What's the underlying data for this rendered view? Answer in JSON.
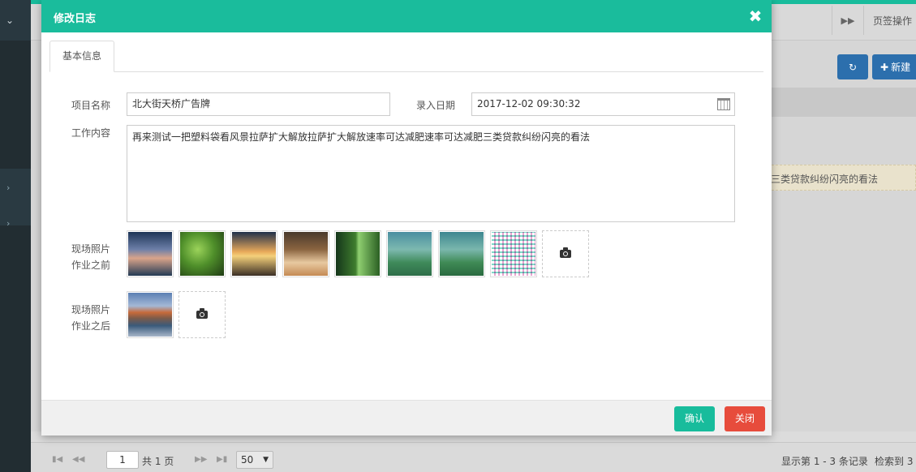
{
  "background": {
    "tab_operations": "页签操作",
    "new_button": "新建",
    "row_text": "三类贷款纠纷闪亮的看法",
    "footer": {
      "current_page": "1",
      "total_pages": "共 1 页",
      "page_size": "50",
      "showing": "显示第 1 - 3 条记录",
      "found": "检索到 3"
    }
  },
  "modal": {
    "title": "修改日志",
    "tab_basic": "基本信息",
    "form": {
      "project_label": "项目名称",
      "project_value": "北大街天桥广告牌",
      "date_label": "录入日期",
      "date_value": "2017-12-02 09:30:32",
      "work_label": "工作内容",
      "work_value": "再来测试一把塑料袋看风景拉萨扩大解放拉萨扩大解放速率可达减肥速率可达减肥三类贷款纠纷闪亮的看法",
      "before_label_1": "现场照片",
      "before_label_2": "作业之前",
      "after_label_1": "现场照片",
      "after_label_2": "作业之后"
    },
    "confirm_button": "确认",
    "close_button": "关闭"
  },
  "colors": {
    "header": "#1abc9c",
    "confirm": "#18bc9c",
    "close": "#e74c3c",
    "sidebar": "#222d32"
  }
}
